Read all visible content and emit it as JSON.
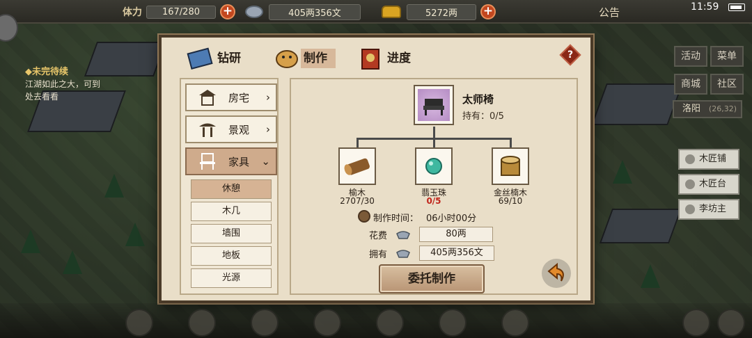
{
  "topbar": {
    "stamina_label": "体力",
    "stamina_value": "167/280",
    "silver_value": "405两356文",
    "gold_value": "5272两",
    "notice_label": "公告",
    "time": "11:59"
  },
  "quest": {
    "title": "◆未完待续",
    "text": "江湖如此之大，可到处去看看"
  },
  "right_panel": {
    "buttons": [
      "活动",
      "菜单",
      "商城",
      "社区"
    ],
    "city": "洛阳",
    "coord": "(26,32)",
    "shops": [
      "木匠铺",
      "木匠台",
      "李坊主"
    ]
  },
  "dialog": {
    "tabs": [
      {
        "label": "钻研",
        "active": false
      },
      {
        "label": "制作",
        "active": true
      },
      {
        "label": "进度",
        "active": false
      }
    ],
    "help": "?",
    "categories": [
      {
        "label": "房宅",
        "arrow": "›"
      },
      {
        "label": "景观",
        "arrow": "›"
      },
      {
        "label": "家具",
        "arrow": "⌄"
      }
    ],
    "subcategories": [
      "休憩",
      "木几",
      "墙围",
      "地板",
      "光源"
    ],
    "product": {
      "name": "太师椅",
      "owned": "持有：0/5"
    },
    "materials": [
      {
        "name": "榆木",
        "count": "2707/30",
        "lack": false
      },
      {
        "name": "翡玉珠",
        "count": "0/5",
        "lack": true
      },
      {
        "name": "金丝楠木",
        "count": "69/10",
        "lack": false
      }
    ],
    "craft_time_label": "制作时间：",
    "craft_time_value": "06小时00分",
    "cost_label": "花费",
    "cost_value": "80两",
    "have_label": "拥有",
    "have_value": "405两356文",
    "craft_button": "委托制作"
  },
  "colors": {
    "dialog_bg": "#e9dec8",
    "active_tab": "#d7b89a",
    "lack_red": "#c0241a",
    "plus_orange": "#c2471f"
  }
}
